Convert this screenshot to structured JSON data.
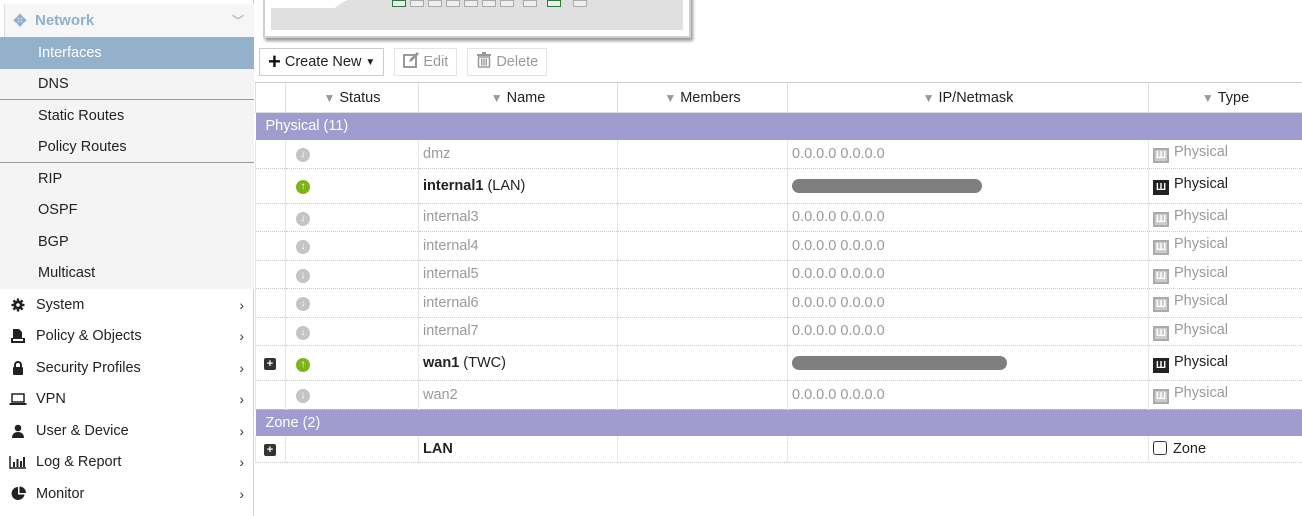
{
  "sidebar": {
    "network": {
      "label": "Network",
      "icon": "network-arrows-icon"
    },
    "sub_items": [
      {
        "label": "Interfaces",
        "active": true
      },
      {
        "label": "DNS"
      },
      {
        "label": "Static Routes"
      },
      {
        "label": "Policy Routes"
      },
      {
        "label": "RIP"
      },
      {
        "label": "OSPF"
      },
      {
        "label": "BGP"
      },
      {
        "label": "Multicast"
      }
    ],
    "items": [
      {
        "label": "System",
        "icon": "gear-icon"
      },
      {
        "label": "Policy & Objects",
        "icon": "policy-document-icon"
      },
      {
        "label": "Security Profiles",
        "icon": "lock-icon"
      },
      {
        "label": "VPN",
        "icon": "laptop-icon"
      },
      {
        "label": "User & Device",
        "icon": "user-icon"
      },
      {
        "label": "Log & Report",
        "icon": "bar-chart-icon"
      },
      {
        "label": "Monitor",
        "icon": "pie-chart-icon"
      }
    ]
  },
  "toolbar": {
    "create_new": "Create New",
    "edit": "Edit",
    "delete": "Delete"
  },
  "table": {
    "columns": [
      "Status",
      "Name",
      "Members",
      "IP/Netmask",
      "Type"
    ],
    "groups": [
      {
        "label": "Physical (11)",
        "rows": [
          {
            "status": "down",
            "name": "dmz",
            "alias": "",
            "members": "",
            "ip": "0.0.0.0 0.0.0.0",
            "type": "Physical",
            "expandable": false
          },
          {
            "status": "up",
            "name": "internal1",
            "alias": "(LAN)",
            "members": "",
            "ip": "[redacted]",
            "type": "Physical",
            "expandable": false
          },
          {
            "status": "down",
            "name": "internal3",
            "alias": "",
            "members": "",
            "ip": "0.0.0.0 0.0.0.0",
            "type": "Physical",
            "expandable": false
          },
          {
            "status": "down",
            "name": "internal4",
            "alias": "",
            "members": "",
            "ip": "0.0.0.0 0.0.0.0",
            "type": "Physical",
            "expandable": false
          },
          {
            "status": "down",
            "name": "internal5",
            "alias": "",
            "members": "",
            "ip": "0.0.0.0 0.0.0.0",
            "type": "Physical",
            "expandable": false
          },
          {
            "status": "down",
            "name": "internal6",
            "alias": "",
            "members": "",
            "ip": "0.0.0.0 0.0.0.0",
            "type": "Physical",
            "expandable": false
          },
          {
            "status": "down",
            "name": "internal7",
            "alias": "",
            "members": "",
            "ip": "0.0.0.0 0.0.0.0",
            "type": "Physical",
            "expandable": false
          },
          {
            "status": "up",
            "name": "wan1",
            "alias": "(TWC)",
            "members": "",
            "ip": "[redacted]",
            "type": "Physical",
            "expandable": true
          },
          {
            "status": "down",
            "name": "wan2",
            "alias": "",
            "members": "",
            "ip": "0.0.0.0 0.0.0.0",
            "type": "Physical",
            "expandable": false
          }
        ]
      },
      {
        "label": "Zone (2)",
        "rows": [
          {
            "status": "",
            "name": "LAN",
            "alias": "",
            "members": "",
            "ip": "",
            "type": "Zone",
            "expandable": true
          }
        ]
      }
    ]
  },
  "colors": {
    "group_header": "#a19ccf",
    "active_nav": "#93b1cb",
    "status_up": "#7cb518",
    "status_down": "#c4c4c4"
  }
}
